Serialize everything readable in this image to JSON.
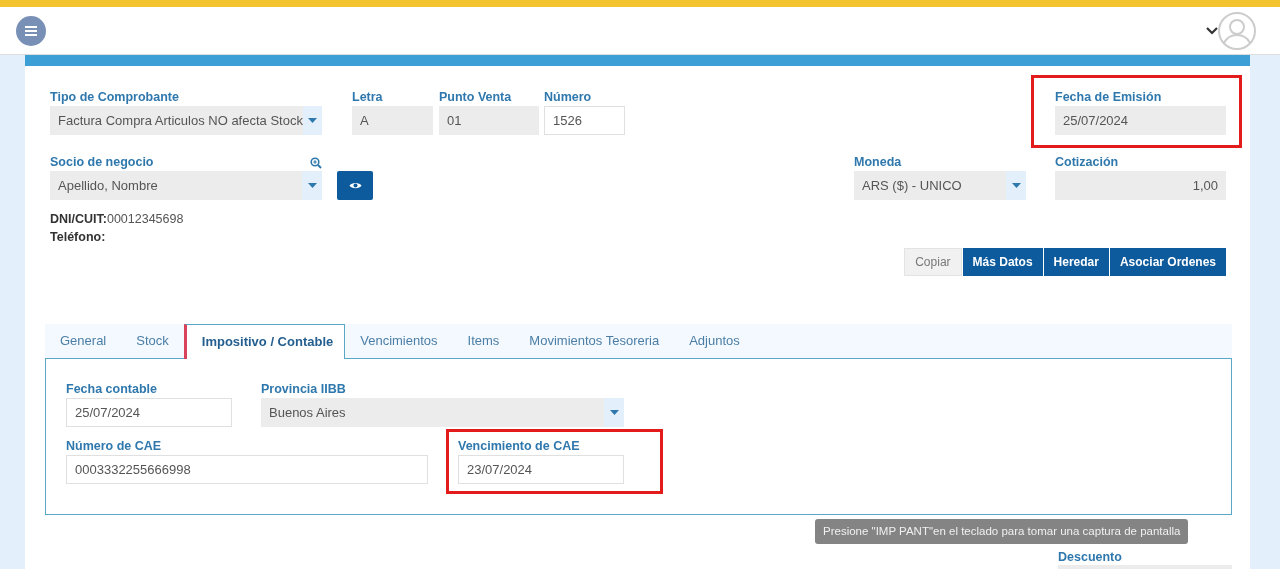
{
  "document": {
    "fields": [
      {
        "label": "Tipo de Comprobante",
        "value": "Factura Compra Articulos NO afecta Stock",
        "kind": "select",
        "highlighted": false
      },
      {
        "label": "Letra",
        "value": "A",
        "kind": "readonly",
        "highlighted": false
      },
      {
        "label": "Punto Venta",
        "value": "01",
        "kind": "readonly",
        "highlighted": false
      },
      {
        "label": "Número",
        "value": "1526",
        "kind": "input",
        "highlighted": false
      },
      {
        "label": "Fecha de Emisión",
        "value": "25/07/2024",
        "kind": "readonly",
        "highlighted": true
      },
      {
        "label": "Socio de negocio",
        "value": "Apellido, Nombre",
        "kind": "select",
        "highlighted": false
      },
      {
        "label": "Moneda",
        "value": "ARS ($) - UNICO",
        "kind": "select",
        "highlighted": false
      },
      {
        "label": "Cotización",
        "value": "1,00",
        "kind": "readonly-number",
        "highlighted": false
      }
    ]
  },
  "partner_info": [
    {
      "label": "DNI/CUIT:",
      "value": "00012345698"
    },
    {
      "label": "Teléfono:"
    }
  ],
  "actions": [
    {
      "label": "Copiar",
      "kind": "light"
    },
    {
      "label": "Más Datos",
      "kind": "primary"
    },
    {
      "label": "Heredar",
      "kind": "primary"
    },
    {
      "label": "Asociar Ordenes",
      "kind": "primary"
    }
  ],
  "tabs": [
    {
      "label": "General",
      "selected": false
    },
    {
      "label": "Stock",
      "selected": false
    },
    {
      "label": "Impositivo / Contable",
      "selected": true
    },
    {
      "label": "Vencimientos",
      "selected": false
    },
    {
      "label": "Items",
      "selected": false
    },
    {
      "label": "Movimientos Tesoreria",
      "selected": false
    },
    {
      "label": "Adjuntos",
      "selected": false
    }
  ],
  "tab_panel": {
    "fields": [
      {
        "label": "Fecha contable",
        "value": "25/07/2024",
        "kind": "input",
        "highlighted": false
      },
      {
        "label": "Provincia IIBB",
        "value": "Buenos Aires",
        "kind": "select",
        "highlighted": false
      },
      {
        "label": "Número de CAE",
        "value": "0003332255666998",
        "kind": "input",
        "highlighted": false
      },
      {
        "label": "Vencimiento de CAE",
        "value": "23/07/2024",
        "kind": "input",
        "highlighted": true
      }
    ]
  },
  "totals": {
    "label": "Descuento"
  },
  "toast": {
    "text": "Presione \"IMP PANT\"en el teclado para tomar una captura de pantalla"
  }
}
